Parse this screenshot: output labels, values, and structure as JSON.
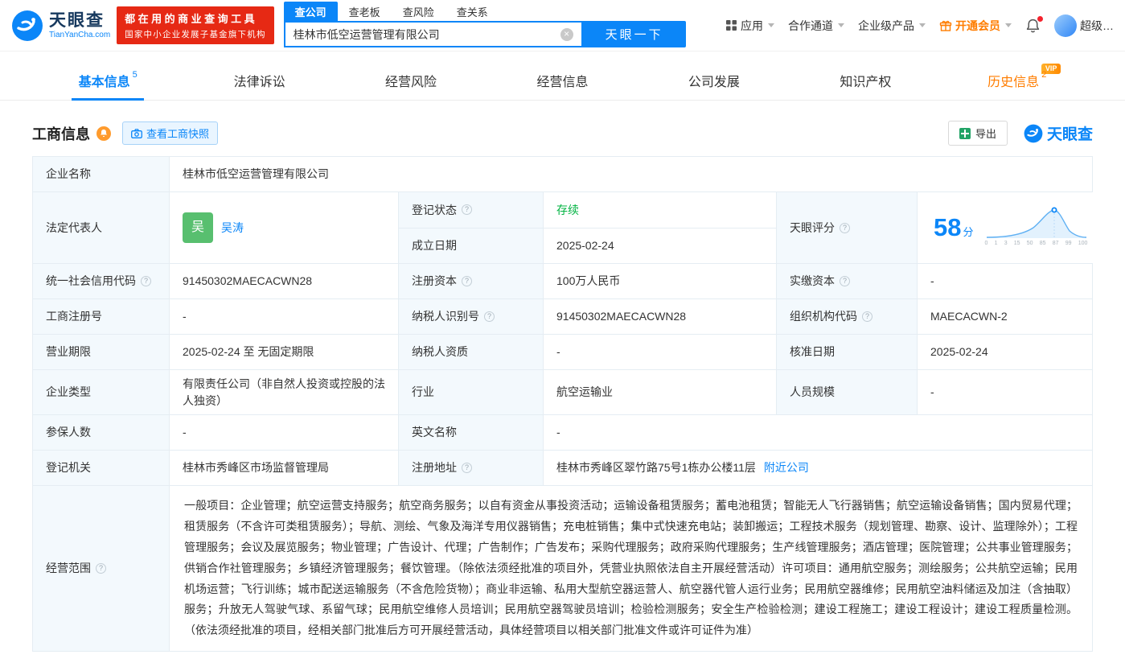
{
  "colors": {
    "accent": "#0b86f8",
    "orange": "#ff7d00",
    "red": "#e62914",
    "green": "#00b341",
    "label_bg": "#f3f9fd"
  },
  "icons": {
    "info": "?",
    "clear": "×"
  },
  "header": {
    "logo": {
      "brand": "天眼查",
      "domain": "TianYanCha.com"
    },
    "slogan": {
      "line1": "都在用的商业查询工具",
      "line2": "国家中小企业发展子基金旗下机构"
    },
    "search": {
      "tabs": [
        {
          "label": "查公司"
        },
        {
          "label": "查老板"
        },
        {
          "label": "查风险"
        },
        {
          "label": "查关系"
        }
      ],
      "value": "桂林市低空运营管理有限公司",
      "button": "天眼一下"
    },
    "nav": {
      "apps": "应用",
      "cooperation": "合作通道",
      "enterprise": "企业级产品",
      "membership": "开通会员",
      "user": "超级…"
    }
  },
  "tabs": {
    "items": [
      {
        "label": "基本信息",
        "badge": "5"
      },
      {
        "label": "法律诉讼",
        "badge": ""
      },
      {
        "label": "经营风险",
        "badge": ""
      },
      {
        "label": "经营信息",
        "badge": ""
      },
      {
        "label": "公司发展",
        "badge": ""
      },
      {
        "label": "知识产权",
        "badge": ""
      },
      {
        "label": "历史信息",
        "badge": "2",
        "vip": "VIP"
      }
    ]
  },
  "section": {
    "title": "工商信息",
    "snapshot_button": "查看工商快照",
    "export_button": "导出",
    "brand": "天眼查"
  },
  "business": {
    "name_label": "企业名称",
    "name": "桂林市低空运营管理有限公司",
    "legal_rep_label": "法定代表人",
    "legal_rep_avatar": "吴",
    "legal_rep": "吴涛",
    "reg_status_label": "登记状态",
    "reg_status": "存续",
    "established_label": "成立日期",
    "established": "2025-02-24",
    "score_label": "天眼评分",
    "score": "58",
    "score_unit": "分",
    "credit_code_label": "统一社会信用代码",
    "credit_code": "91450302MAECACWN28",
    "reg_capital_label": "注册资本",
    "reg_capital": "100万人民币",
    "paid_capital_label": "实缴资本",
    "paid_capital": "-",
    "reg_no_label": "工商注册号",
    "reg_no": "-",
    "taxpayer_id_label": "纳税人识别号",
    "taxpayer_id": "91450302MAECACWN28",
    "org_code_label": "组织机构代码",
    "org_code": "MAECACWN-2",
    "term_label": "营业期限",
    "term": "2025-02-24 至 无固定期限",
    "taxpayer_quality_label": "纳税人资质",
    "taxpayer_quality": "-",
    "approved_label": "核准日期",
    "approved": "2025-02-24",
    "type_label": "企业类型",
    "type": "有限责任公司（非自然人投资或控股的法人独资）",
    "industry_label": "行业",
    "industry": "航空运输业",
    "staff_label": "人员规模",
    "staff": "-",
    "insured_label": "参保人数",
    "insured": "-",
    "en_name_label": "英文名称",
    "en_name": "-",
    "registry_label": "登记机关",
    "registry": "桂林市秀峰区市场监督管理局",
    "address_label": "注册地址",
    "address": "桂林市秀峰区翠竹路75号1栋办公楼11层",
    "nearby": "附近公司",
    "scope_label": "经营范围",
    "scope": "一般项目：企业管理；航空运营支持服务；航空商务服务；以自有资金从事投资活动；运输设备租赁服务；蓄电池租赁；智能无人飞行器销售；航空运输设备销售；国内贸易代理；租赁服务（不含许可类租赁服务）；导航、测绘、气象及海洋专用仪器销售；充电桩销售；集中式快速充电站；装卸搬运；工程技术服务（规划管理、勘察、设计、监理除外）；工程管理服务；会议及展览服务；物业管理；广告设计、代理；广告制作；广告发布；采购代理服务；政府采购代理服务；生产线管理服务；酒店管理；医院管理；公共事业管理服务；供销合作社管理服务；乡镇经济管理服务；餐饮管理。（除依法须经批准的项目外，凭营业执照依法自主开展经营活动）许可项目：通用航空服务；测绘服务；公共航空运输；民用机场运营；飞行训练；城市配送运输服务（不含危险货物）；商业非运输、私用大型航空器运营人、航空器代管人运行业务；民用航空器维修；民用航空油料储运及加注（含抽取）服务；升放无人驾驶气球、系留气球；民用航空维修人员培训；民用航空器驾驶员培训；检验检测服务；安全生产检验检测；建设工程施工；建设工程设计；建设工程质量检测。（依法须经批准的项目，经相关部门批准后方可开展经营活动，具体经营项目以相关部门批准文件或许可证件为准）"
  },
  "score_chart": {
    "type": "line",
    "score": 58,
    "axis_labels": [
      "0",
      "1",
      "3",
      "15",
      "50",
      "85",
      "87",
      "99",
      "100"
    ]
  }
}
